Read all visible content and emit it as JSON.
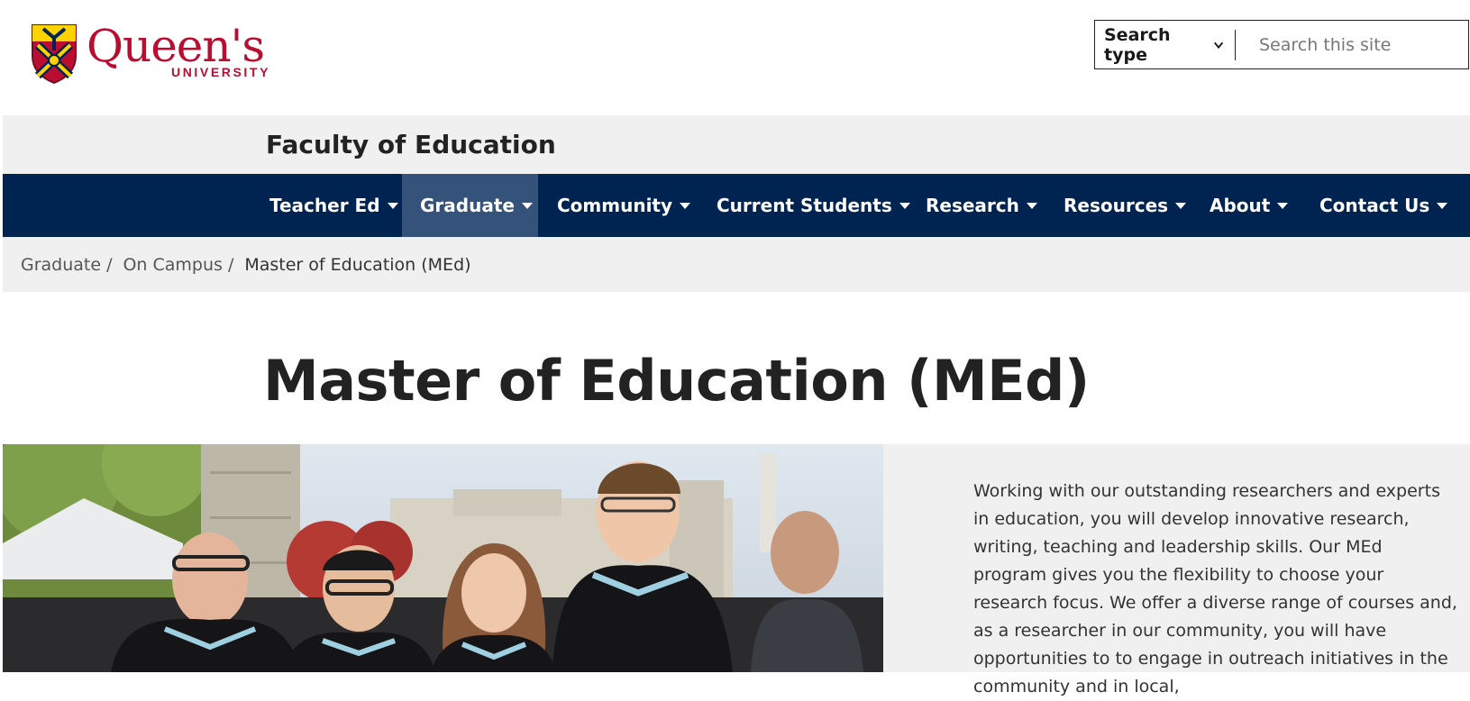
{
  "header": {
    "logo_name": "Queen's",
    "logo_subtitle": "UNIVERSITY",
    "search_type_label": "Search type",
    "search_placeholder": "Search this site"
  },
  "faculty": {
    "title": "Faculty of Education"
  },
  "nav": {
    "items": [
      {
        "label": "Teacher Ed"
      },
      {
        "label": "Graduate"
      },
      {
        "label": "Community"
      },
      {
        "label": "Current Students"
      },
      {
        "label": "Research"
      },
      {
        "label": "Resources"
      },
      {
        "label": "About"
      },
      {
        "label": "Contact Us"
      }
    ],
    "active": "Graduate"
  },
  "breadcrumb": {
    "items": [
      {
        "label": "Graduate",
        "sep": "/"
      },
      {
        "label": "On Campus",
        "sep": "/"
      }
    ],
    "current": "Master of Education (MEd)"
  },
  "page": {
    "title": "Master of Education (MEd)"
  },
  "hero": {
    "text": "Working with our outstanding researchers and experts in education, you will develop innovative research, writing, teaching and leadership skills. Our MEd program gives you the flexibility to choose your research focus. We offer a diverse range of courses and, as a researcher in our community, you will have opportunities to to engage in outreach initiatives in the community and in local,"
  },
  "colors": {
    "brand_red": "#b90e31",
    "nav_blue": "#002452",
    "nav_active": "#34527a",
    "band_grey": "#eff0ef"
  }
}
